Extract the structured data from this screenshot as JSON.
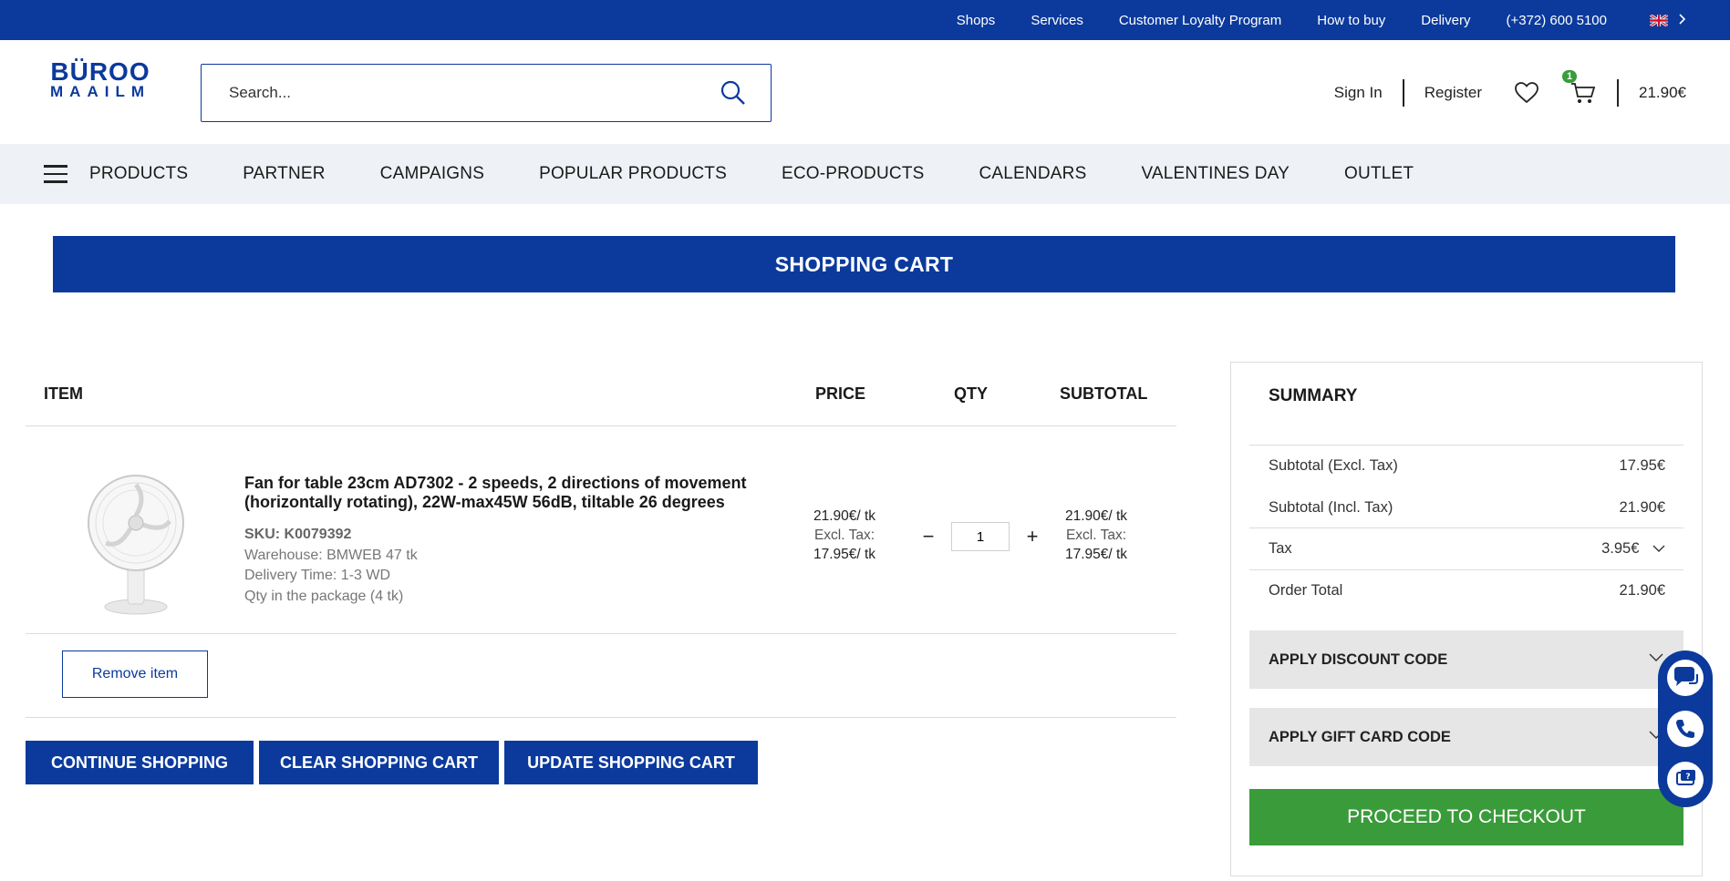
{
  "topbar": {
    "links": [
      "Shops",
      "Services",
      "Customer Loyalty Program",
      "How to buy",
      "Delivery",
      "(+372) 600 5100"
    ]
  },
  "header": {
    "logo_line1": "BÜROO",
    "logo_line2": "MAAILM",
    "search_placeholder": "Search...",
    "sign_in": "Sign In",
    "register": "Register",
    "cart_count": "1",
    "cart_total": "21.90€"
  },
  "nav": {
    "items": [
      "PRODUCTS",
      "PARTNER",
      "CAMPAIGNS",
      "POPULAR PRODUCTS",
      "ECO-PRODUCTS",
      "CALENDARS",
      "VALENTINES DAY",
      "OUTLET"
    ]
  },
  "banner": {
    "title": "SHOPPING CART"
  },
  "table": {
    "headers": {
      "item": "ITEM",
      "price": "PRICE",
      "qty": "QTY",
      "subtotal": "SUBTOTAL"
    }
  },
  "product": {
    "name": "Fan for table 23cm AD7302 - 2 speeds, 2 directions of movement (horizontally rotating), 22W-max45W 56dB, tiltable 26 degrees",
    "sku": "SKU: K0079392",
    "warehouse": "Warehouse: BMWEB 47 tk",
    "delivery": "Delivery Time: 1-3 WD",
    "package": "Qty in the package (4 tk)",
    "price": "21.90€/ tk",
    "price_excl_label": "Excl. Tax:",
    "price_excl": "17.95€/ tk",
    "qty": "1",
    "subtotal": "21.90€/ tk",
    "subtotal_excl_label": "Excl. Tax:",
    "subtotal_excl": "17.95€/ tk"
  },
  "actions": {
    "remove": "Remove item",
    "continue": "CONTINUE SHOPPING",
    "clear": "CLEAR SHOPPING CART",
    "update": "UPDATE SHOPPING CART"
  },
  "summary": {
    "title": "SUMMARY",
    "subtotal_excl_label": "Subtotal (Excl. Tax)",
    "subtotal_excl": "17.95€",
    "subtotal_incl_label": "Subtotal (Incl. Tax)",
    "subtotal_incl": "21.90€",
    "tax_label": "Tax",
    "tax": "3.95€",
    "order_total_label": "Order Total",
    "order_total": "21.90€",
    "discount": "APPLY DISCOUNT CODE",
    "gift": "APPLY GIFT CARD CODE",
    "checkout": "PROCEED TO CHECKOUT"
  },
  "colors": {
    "brand": "#0b3a9c",
    "checkout": "#3a9b3a",
    "nav_bg": "#eef1f5"
  }
}
